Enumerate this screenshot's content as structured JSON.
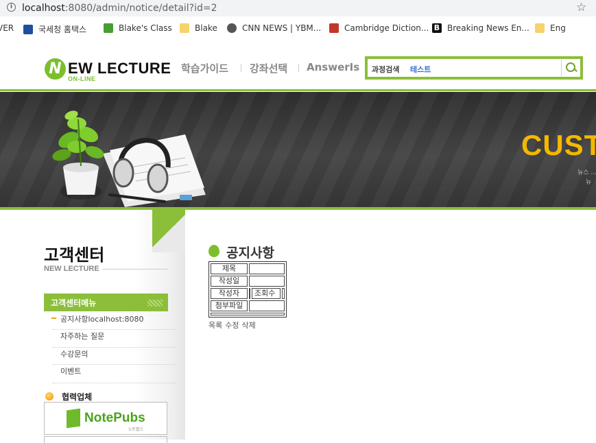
{
  "browser": {
    "url_host": "localhost",
    "url_path": ":8080/admin/notice/detail?id=2",
    "bookmarks": [
      {
        "label": "VER"
      },
      {
        "label": "국세청 홈택스"
      },
      {
        "label": "Blake's Class"
      },
      {
        "label": "Blake"
      },
      {
        "label": "CNN NEWS | YBM..."
      },
      {
        "label": "Cambridge Diction..."
      },
      {
        "label": "Breaking News En..."
      },
      {
        "label": "Eng"
      }
    ]
  },
  "header": {
    "logo_letter": "N",
    "logo_text": "EW LECTURE",
    "logo_sub": "ON-LINE",
    "nav": [
      "학습가이드",
      "강좌선택",
      "AnswerIs"
    ],
    "search": {
      "label": "과정검색",
      "value": "테스트"
    }
  },
  "banner": {
    "title": "CUST",
    "sub1": "뉴스 ...",
    "sub2": "뉴"
  },
  "sidebar": {
    "title": "고객센터",
    "subtitle": "NEW LECTURE",
    "menu_title": "고객센터메뉴",
    "items": [
      {
        "label": "공지사항localhost:8080"
      },
      {
        "label": "자주하는 질문"
      },
      {
        "label": "수강문의"
      },
      {
        "label": "이벤트"
      }
    ],
    "partner_label": "협력업체",
    "partner_name": "NotePubs",
    "partner_sub": "노트펍스"
  },
  "main": {
    "title": "공지사항",
    "table": {
      "subject_label": "제목",
      "date_label": "작성일",
      "writer_label": "작성자",
      "views_label": "조회수",
      "attachment_label": "첨부파일"
    },
    "actions": [
      "목록",
      "수정",
      "삭제"
    ]
  },
  "colors": {
    "accent": "#8cbe3a",
    "banner_title": "#f5b800"
  }
}
